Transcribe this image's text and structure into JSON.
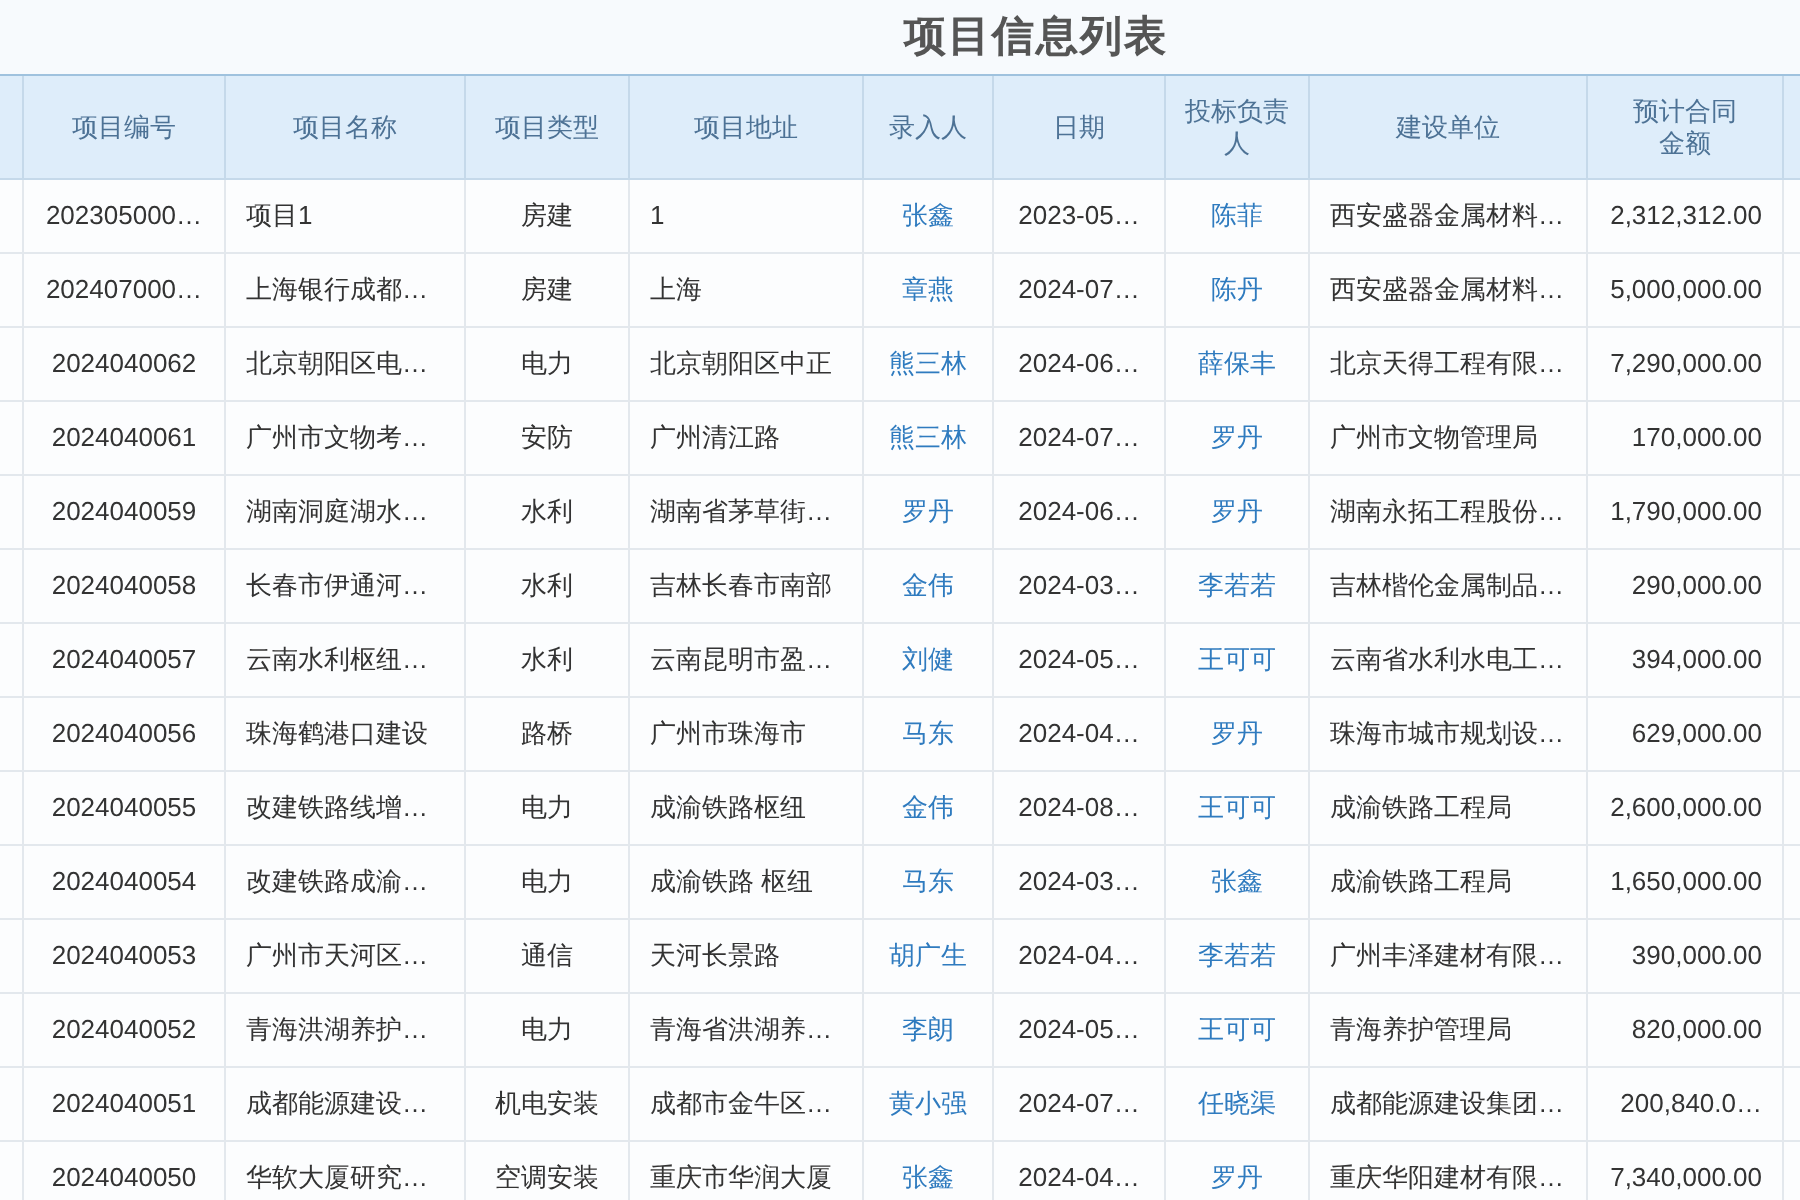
{
  "title": "项目信息列表",
  "columns": [
    {
      "label": "项目编号",
      "kind": "center"
    },
    {
      "label": "项目名称",
      "kind": "left"
    },
    {
      "label": "项目类型",
      "kind": "center"
    },
    {
      "label": "项目地址",
      "kind": "left"
    },
    {
      "label": "录入人",
      "kind": "link"
    },
    {
      "label": "日期",
      "kind": "center"
    },
    {
      "label": "投标负责人",
      "kind": "link"
    },
    {
      "label": "建设单位",
      "kind": "left"
    },
    {
      "label": "预计合同金额",
      "kind": "right"
    }
  ],
  "rows": [
    [
      "202305000…",
      "项目1",
      "房建",
      "1",
      "张鑫",
      "2023-05…",
      "陈菲",
      "西安盛器金属材料…",
      "2,312,312.00"
    ],
    [
      "202407000…",
      "上海银行成都…",
      "房建",
      "上海",
      "章燕",
      "2024-07…",
      "陈丹",
      "西安盛器金属材料…",
      "5,000,000.00"
    ],
    [
      "2024040062",
      "北京朝阳区电…",
      "电力",
      "北京朝阳区中正",
      "熊三林",
      "2024-06…",
      "薛保丰",
      "北京天得工程有限…",
      "7,290,000.00"
    ],
    [
      "2024040061",
      "广州市文物考…",
      "安防",
      "广州清江路",
      "熊三林",
      "2024-07…",
      "罗丹",
      "广州市文物管理局",
      "170,000.00"
    ],
    [
      "2024040059",
      "湖南洞庭湖水…",
      "水利",
      "湖南省茅草街…",
      "罗丹",
      "2024-06…",
      "罗丹",
      "湖南永拓工程股份…",
      "1,790,000.00"
    ],
    [
      "2024040058",
      "长春市伊通河…",
      "水利",
      "吉林长春市南部",
      "金伟",
      "2024-03…",
      "李若若",
      "吉林楷伦金属制品…",
      "290,000.00"
    ],
    [
      "2024040057",
      "云南水利枢纽…",
      "水利",
      "云南昆明市盈…",
      "刘健",
      "2024-05…",
      "王可可",
      "云南省水利水电工…",
      "394,000.00"
    ],
    [
      "2024040056",
      "珠海鹤港口建设",
      "路桥",
      "广州市珠海市",
      "马东",
      "2024-04…",
      "罗丹",
      "珠海市城市规划设…",
      "629,000.00"
    ],
    [
      "2024040055",
      "改建铁路线增…",
      "电力",
      "成渝铁路枢纽",
      "金伟",
      "2024-08…",
      "王可可",
      "成渝铁路工程局",
      "2,600,000.00"
    ],
    [
      "2024040054",
      "改建铁路成渝…",
      "电力",
      "成渝铁路 枢纽",
      "马东",
      "2024-03…",
      "张鑫",
      "成渝铁路工程局",
      "1,650,000.00"
    ],
    [
      "2024040053",
      "广州市天河区…",
      "通信",
      "天河长景路",
      "胡广生",
      "2024-04…",
      "李若若",
      "广州丰泽建材有限…",
      "390,000.00"
    ],
    [
      "2024040052",
      "青海洪湖养护…",
      "电力",
      "青海省洪湖养…",
      "李朗",
      "2024-05…",
      "王可可",
      "青海养护管理局",
      "820,000.00"
    ],
    [
      "2024040051",
      "成都能源建设…",
      "机电安装",
      "成都市金牛区…",
      "黄小强",
      "2024-07…",
      "任晓渠",
      "成都能源建设集团…",
      "200,840.0…"
    ],
    [
      "2024040050",
      "华软大厦研究…",
      "空调安装",
      "重庆市华润大厦",
      "张鑫",
      "2024-04…",
      "罗丹",
      "重庆华阳建材有限…",
      "7,340,000.00"
    ]
  ]
}
